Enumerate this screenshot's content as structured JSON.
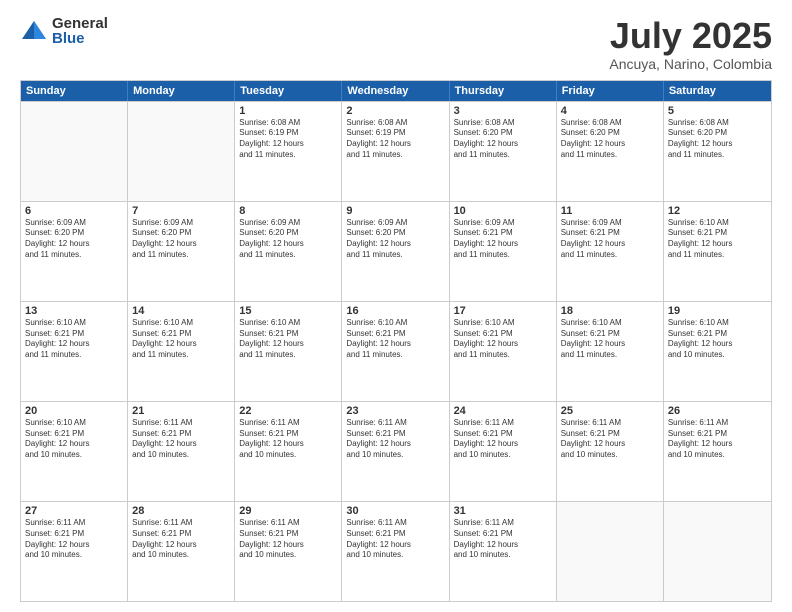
{
  "logo": {
    "general": "General",
    "blue": "Blue"
  },
  "title": "July 2025",
  "location": "Ancuya, Narino, Colombia",
  "header_days": [
    "Sunday",
    "Monday",
    "Tuesday",
    "Wednesday",
    "Thursday",
    "Friday",
    "Saturday"
  ],
  "weeks": [
    [
      {
        "day": "",
        "info": ""
      },
      {
        "day": "",
        "info": ""
      },
      {
        "day": "1",
        "info": "Sunrise: 6:08 AM\nSunset: 6:19 PM\nDaylight: 12 hours\nand 11 minutes."
      },
      {
        "day": "2",
        "info": "Sunrise: 6:08 AM\nSunset: 6:19 PM\nDaylight: 12 hours\nand 11 minutes."
      },
      {
        "day": "3",
        "info": "Sunrise: 6:08 AM\nSunset: 6:20 PM\nDaylight: 12 hours\nand 11 minutes."
      },
      {
        "day": "4",
        "info": "Sunrise: 6:08 AM\nSunset: 6:20 PM\nDaylight: 12 hours\nand 11 minutes."
      },
      {
        "day": "5",
        "info": "Sunrise: 6:08 AM\nSunset: 6:20 PM\nDaylight: 12 hours\nand 11 minutes."
      }
    ],
    [
      {
        "day": "6",
        "info": "Sunrise: 6:09 AM\nSunset: 6:20 PM\nDaylight: 12 hours\nand 11 minutes."
      },
      {
        "day": "7",
        "info": "Sunrise: 6:09 AM\nSunset: 6:20 PM\nDaylight: 12 hours\nand 11 minutes."
      },
      {
        "day": "8",
        "info": "Sunrise: 6:09 AM\nSunset: 6:20 PM\nDaylight: 12 hours\nand 11 minutes."
      },
      {
        "day": "9",
        "info": "Sunrise: 6:09 AM\nSunset: 6:20 PM\nDaylight: 12 hours\nand 11 minutes."
      },
      {
        "day": "10",
        "info": "Sunrise: 6:09 AM\nSunset: 6:21 PM\nDaylight: 12 hours\nand 11 minutes."
      },
      {
        "day": "11",
        "info": "Sunrise: 6:09 AM\nSunset: 6:21 PM\nDaylight: 12 hours\nand 11 minutes."
      },
      {
        "day": "12",
        "info": "Sunrise: 6:10 AM\nSunset: 6:21 PM\nDaylight: 12 hours\nand 11 minutes."
      }
    ],
    [
      {
        "day": "13",
        "info": "Sunrise: 6:10 AM\nSunset: 6:21 PM\nDaylight: 12 hours\nand 11 minutes."
      },
      {
        "day": "14",
        "info": "Sunrise: 6:10 AM\nSunset: 6:21 PM\nDaylight: 12 hours\nand 11 minutes."
      },
      {
        "day": "15",
        "info": "Sunrise: 6:10 AM\nSunset: 6:21 PM\nDaylight: 12 hours\nand 11 minutes."
      },
      {
        "day": "16",
        "info": "Sunrise: 6:10 AM\nSunset: 6:21 PM\nDaylight: 12 hours\nand 11 minutes."
      },
      {
        "day": "17",
        "info": "Sunrise: 6:10 AM\nSunset: 6:21 PM\nDaylight: 12 hours\nand 11 minutes."
      },
      {
        "day": "18",
        "info": "Sunrise: 6:10 AM\nSunset: 6:21 PM\nDaylight: 12 hours\nand 11 minutes."
      },
      {
        "day": "19",
        "info": "Sunrise: 6:10 AM\nSunset: 6:21 PM\nDaylight: 12 hours\nand 10 minutes."
      }
    ],
    [
      {
        "day": "20",
        "info": "Sunrise: 6:10 AM\nSunset: 6:21 PM\nDaylight: 12 hours\nand 10 minutes."
      },
      {
        "day": "21",
        "info": "Sunrise: 6:11 AM\nSunset: 6:21 PM\nDaylight: 12 hours\nand 10 minutes."
      },
      {
        "day": "22",
        "info": "Sunrise: 6:11 AM\nSunset: 6:21 PM\nDaylight: 12 hours\nand 10 minutes."
      },
      {
        "day": "23",
        "info": "Sunrise: 6:11 AM\nSunset: 6:21 PM\nDaylight: 12 hours\nand 10 minutes."
      },
      {
        "day": "24",
        "info": "Sunrise: 6:11 AM\nSunset: 6:21 PM\nDaylight: 12 hours\nand 10 minutes."
      },
      {
        "day": "25",
        "info": "Sunrise: 6:11 AM\nSunset: 6:21 PM\nDaylight: 12 hours\nand 10 minutes."
      },
      {
        "day": "26",
        "info": "Sunrise: 6:11 AM\nSunset: 6:21 PM\nDaylight: 12 hours\nand 10 minutes."
      }
    ],
    [
      {
        "day": "27",
        "info": "Sunrise: 6:11 AM\nSunset: 6:21 PM\nDaylight: 12 hours\nand 10 minutes."
      },
      {
        "day": "28",
        "info": "Sunrise: 6:11 AM\nSunset: 6:21 PM\nDaylight: 12 hours\nand 10 minutes."
      },
      {
        "day": "29",
        "info": "Sunrise: 6:11 AM\nSunset: 6:21 PM\nDaylight: 12 hours\nand 10 minutes."
      },
      {
        "day": "30",
        "info": "Sunrise: 6:11 AM\nSunset: 6:21 PM\nDaylight: 12 hours\nand 10 minutes."
      },
      {
        "day": "31",
        "info": "Sunrise: 6:11 AM\nSunset: 6:21 PM\nDaylight: 12 hours\nand 10 minutes."
      },
      {
        "day": "",
        "info": ""
      },
      {
        "day": "",
        "info": ""
      }
    ]
  ]
}
